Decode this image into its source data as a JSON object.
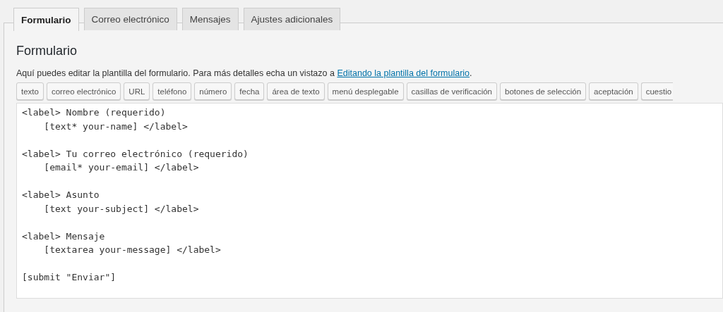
{
  "tabs": [
    {
      "label": "Formulario",
      "selected": true
    },
    {
      "label": "Correo electrónico",
      "selected": false
    },
    {
      "label": "Mensajes",
      "selected": false
    },
    {
      "label": "Ajustes adicionales",
      "selected": false
    }
  ],
  "panel": {
    "heading": "Formulario",
    "description": {
      "text": "Aquí puedes editar la plantilla del formulario. Para más detalles echa un vistazo a ",
      "link": "Editando la plantilla del formulario",
      "after": "."
    },
    "tag_buttons": [
      "texto",
      "correo electrónico",
      "URL",
      "teléfono",
      "número",
      "fecha",
      "área de texto",
      "menú desplegable",
      "casillas de verificación",
      "botones de selección",
      "aceptación",
      "cuestio"
    ],
    "template": "<label> Nombre (requerido)\n    [text* your-name] </label>\n\n<label> Tu correo electrónico (requerido)\n    [email* your-email] </label>\n\n<label> Asunto\n    [text your-subject] </label>\n\n<label> Mensaje\n    [textarea your-message] </label>\n\n[submit \"Enviar\"]"
  }
}
